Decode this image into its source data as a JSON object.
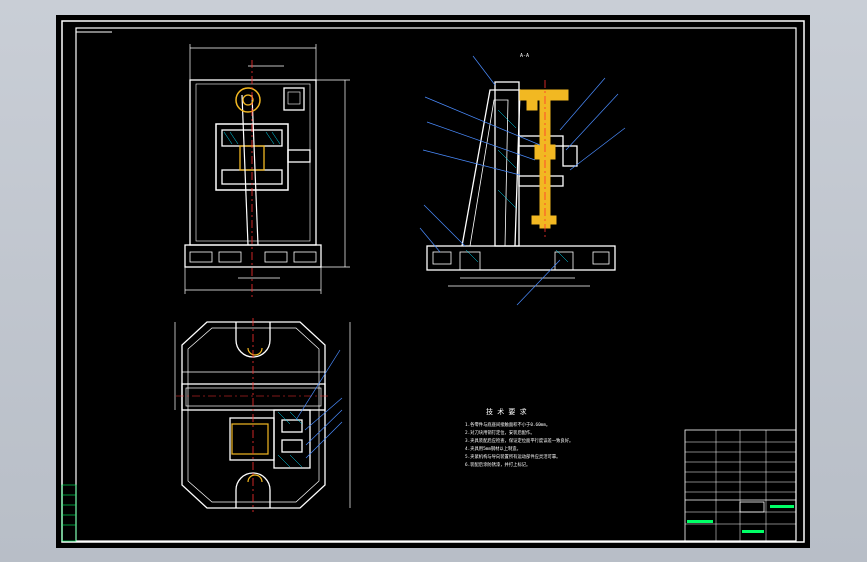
{
  "drawing": {
    "colors": {
      "background": "#000000",
      "frame": "#ffffff",
      "part_highlight": "#f2b822",
      "hatch": "#00e5ff",
      "text": "#ffffff",
      "centerline": "#ff3030",
      "titleblock_accent": "#00ff66"
    },
    "notes_heading": "技 术 要 求",
    "notes": [
      "1.各零件与底座间接触面积不小于0.60mm。",
      "2.对刀块用销钉定位，安装后配作。",
      "3.夹具装配后应检查，保证定位面平行度误差一致良好。",
      "4.夹具用5mm钢材以上制造。",
      "5.夹紧机构与导向装置所有运动部件应灵活可靠。",
      "6.装配后涂防锈漆，并打上标记。"
    ],
    "view_label_side": "A-A"
  }
}
